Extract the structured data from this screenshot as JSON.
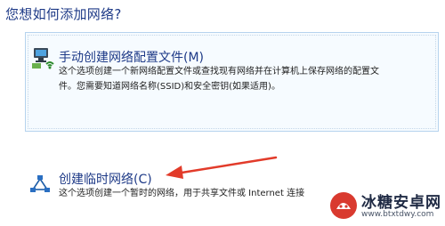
{
  "heading": "您想如何添加网络?",
  "options": [
    {
      "title": "手动创建网络配置文件(M)",
      "desc_line1": "这个选项创建一个新网络配置文件或查找现有网络并在计算机上保存网络的配置文",
      "desc_line2": "件。您需要知道网络名称(SSID)和安全密钥(如果适用)。",
      "icon": "wireless-network-icon"
    },
    {
      "title": "创建临时网络(C)",
      "desc_line1": "这个选项创建一个暂时的网络，用于共享文件或 Internet 连接",
      "icon": "adhoc-network-icon"
    }
  ],
  "annotation": {
    "color": "#e23b2a"
  },
  "watermark": {
    "name": "冰糖安卓网",
    "url": "www.btxtdwy.com"
  }
}
